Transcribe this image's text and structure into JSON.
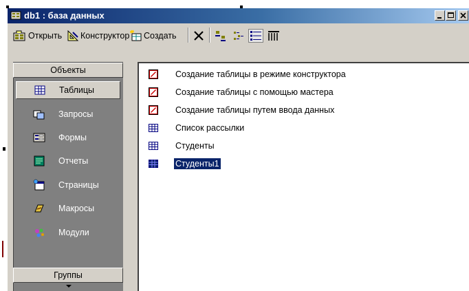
{
  "window": {
    "title": "db1 : база данных"
  },
  "toolbar": {
    "open_label": "Открыть",
    "design_label": "Конструктор",
    "create_label": "Создать"
  },
  "sidebar": {
    "objects_header": "Объекты",
    "groups_header": "Группы",
    "items": [
      {
        "label": "Таблицы",
        "icon": "table-icon",
        "active": true
      },
      {
        "label": "Запросы",
        "icon": "query-icon"
      },
      {
        "label": "Формы",
        "icon": "form-icon"
      },
      {
        "label": "Отчеты",
        "icon": "report-icon"
      },
      {
        "label": "Страницы",
        "icon": "page-icon"
      },
      {
        "label": "Макросы",
        "icon": "macro-icon"
      },
      {
        "label": "Модули",
        "icon": "module-icon"
      }
    ]
  },
  "list": {
    "items": [
      {
        "label": "Создание таблицы в режиме конструктора",
        "icon": "wizard-shortcut-icon"
      },
      {
        "label": "Создание таблицы с помощью мастера",
        "icon": "wizard-shortcut-icon"
      },
      {
        "label": "Создание таблицы путем ввода данных",
        "icon": "wizard-shortcut-icon"
      },
      {
        "label": "Список рассылки",
        "icon": "table-icon"
      },
      {
        "label": "Студенты",
        "icon": "table-icon"
      },
      {
        "label": "Студенты1",
        "icon": "table-icon",
        "selected": true
      }
    ]
  },
  "colors": {
    "titlebar_start": "#0a246a",
    "titlebar_end": "#a6caf0",
    "face": "#d4d0c8",
    "panel": "#808080",
    "selection": "#0a246a"
  }
}
